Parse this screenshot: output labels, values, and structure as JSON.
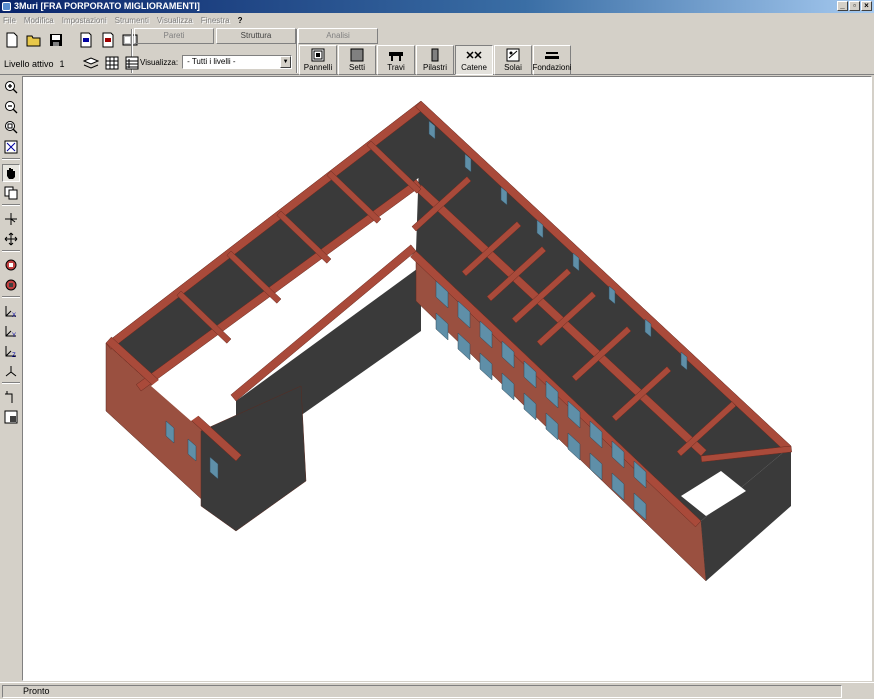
{
  "window": {
    "title": "3Muri  [FRA PORPORATO MIGLIORAMENTI]"
  },
  "menu": [
    "File",
    "Modifica",
    "Impostazioni",
    "Strumenti",
    "Visualizza",
    "Finestra",
    "?"
  ],
  "level": {
    "label": "Livello attivo",
    "value": "1"
  },
  "tabs": [
    "Pareti",
    "Struttura",
    "Analisi"
  ],
  "visualizza": {
    "label": "Visualizza:",
    "selected": "- Tutti i livelli -"
  },
  "element_buttons": [
    {
      "label": "Pannelli",
      "icon": "panel-icon"
    },
    {
      "label": "Setti",
      "icon": "wall-icon"
    },
    {
      "label": "Travi",
      "icon": "beam-icon"
    },
    {
      "label": "Pilastri",
      "icon": "column-icon"
    },
    {
      "label": "Catene",
      "icon": "chain-icon"
    },
    {
      "label": "Solai",
      "icon": "floor-icon"
    },
    {
      "label": "Fondazioni",
      "icon": "foundation-icon"
    }
  ],
  "status": {
    "text": "Pronto"
  },
  "colors": {
    "wall_top": "#a94a3a",
    "wall_face": "#9a5040",
    "wall_dark": "#3a3a3a",
    "window": "#5f8fa8",
    "viewport": "#ffffff"
  }
}
